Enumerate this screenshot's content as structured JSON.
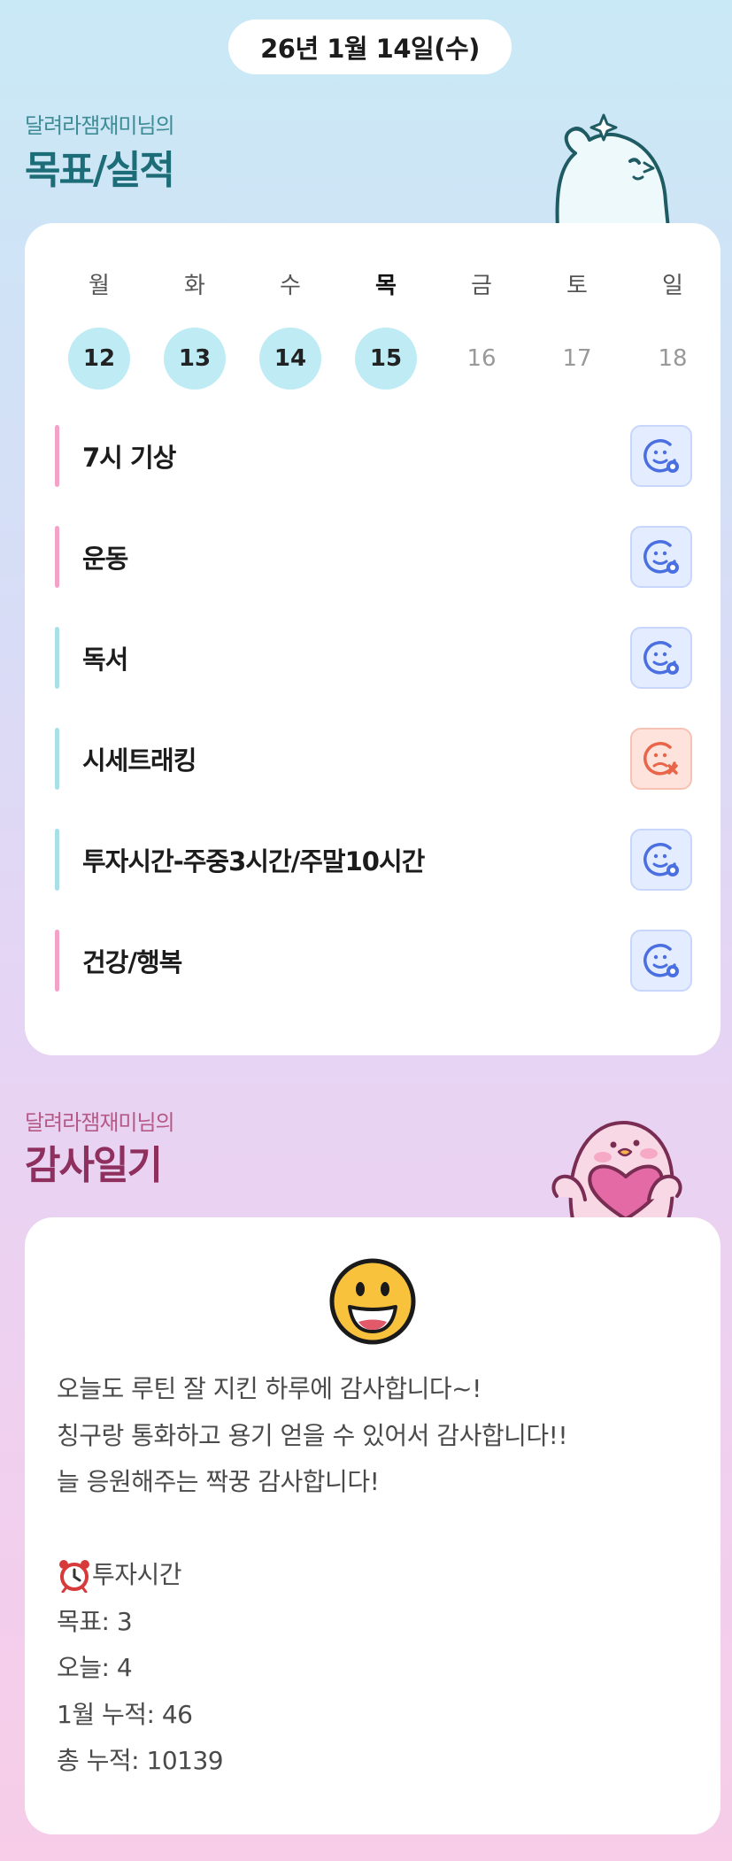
{
  "header": {
    "date": "26년 1월 14일(수)"
  },
  "goals_section": {
    "subtitle": "달려라잼재미님의",
    "title": "목표/실적"
  },
  "week": {
    "days": [
      {
        "dow": "월",
        "date": "12",
        "status": "done"
      },
      {
        "dow": "화",
        "date": "13",
        "status": "done"
      },
      {
        "dow": "수",
        "date": "14",
        "status": "done"
      },
      {
        "dow": "목",
        "date": "15",
        "status": "done",
        "active": true
      },
      {
        "dow": "금",
        "date": "16",
        "status": "future"
      },
      {
        "dow": "토",
        "date": "17",
        "status": "future"
      },
      {
        "dow": "일",
        "date": "18",
        "status": "future"
      }
    ]
  },
  "goals": [
    {
      "label": "7시 기상",
      "color": "#f3a3c8",
      "status": "ok"
    },
    {
      "label": "운동",
      "color": "#f3a3c8",
      "status": "ok"
    },
    {
      "label": "독서",
      "color": "#a8e0e6",
      "status": "ok"
    },
    {
      "label": "시세트래킹",
      "color": "#a8e0e6",
      "status": "fail"
    },
    {
      "label": "투자시간-주중3시간/주말10시간",
      "color": "#a8e0e6",
      "status": "ok"
    },
    {
      "label": "건강/행복",
      "color": "#f3a3c8",
      "status": "ok"
    }
  ],
  "gratitude_section": {
    "subtitle": "달려라잼재미님의",
    "title": "감사일기"
  },
  "diary": {
    "mood_icon": "grinning-face-icon",
    "lines": [
      "오늘도 루틴 잘 지킨 하루에 감사합니다~!",
      "칭구랑 통화하고 용기 얻을 수 있어서 감사합니다!!",
      "늘 응원해주는 짝꿍 감사합니다!"
    ],
    "stats_header": "투자시간",
    "stats_icon": "alarm-clock-icon",
    "stats": [
      "목표: 3",
      "오늘: 4",
      "1월 누적: 46",
      "총 누적: 10139"
    ]
  },
  "colors": {
    "goal_title": "#1d6d78",
    "gratitude_title": "#8e2f5e",
    "done_circle": "#bfecf4",
    "ok_icon": "#4a6fe0",
    "fail_icon": "#e8654a"
  }
}
